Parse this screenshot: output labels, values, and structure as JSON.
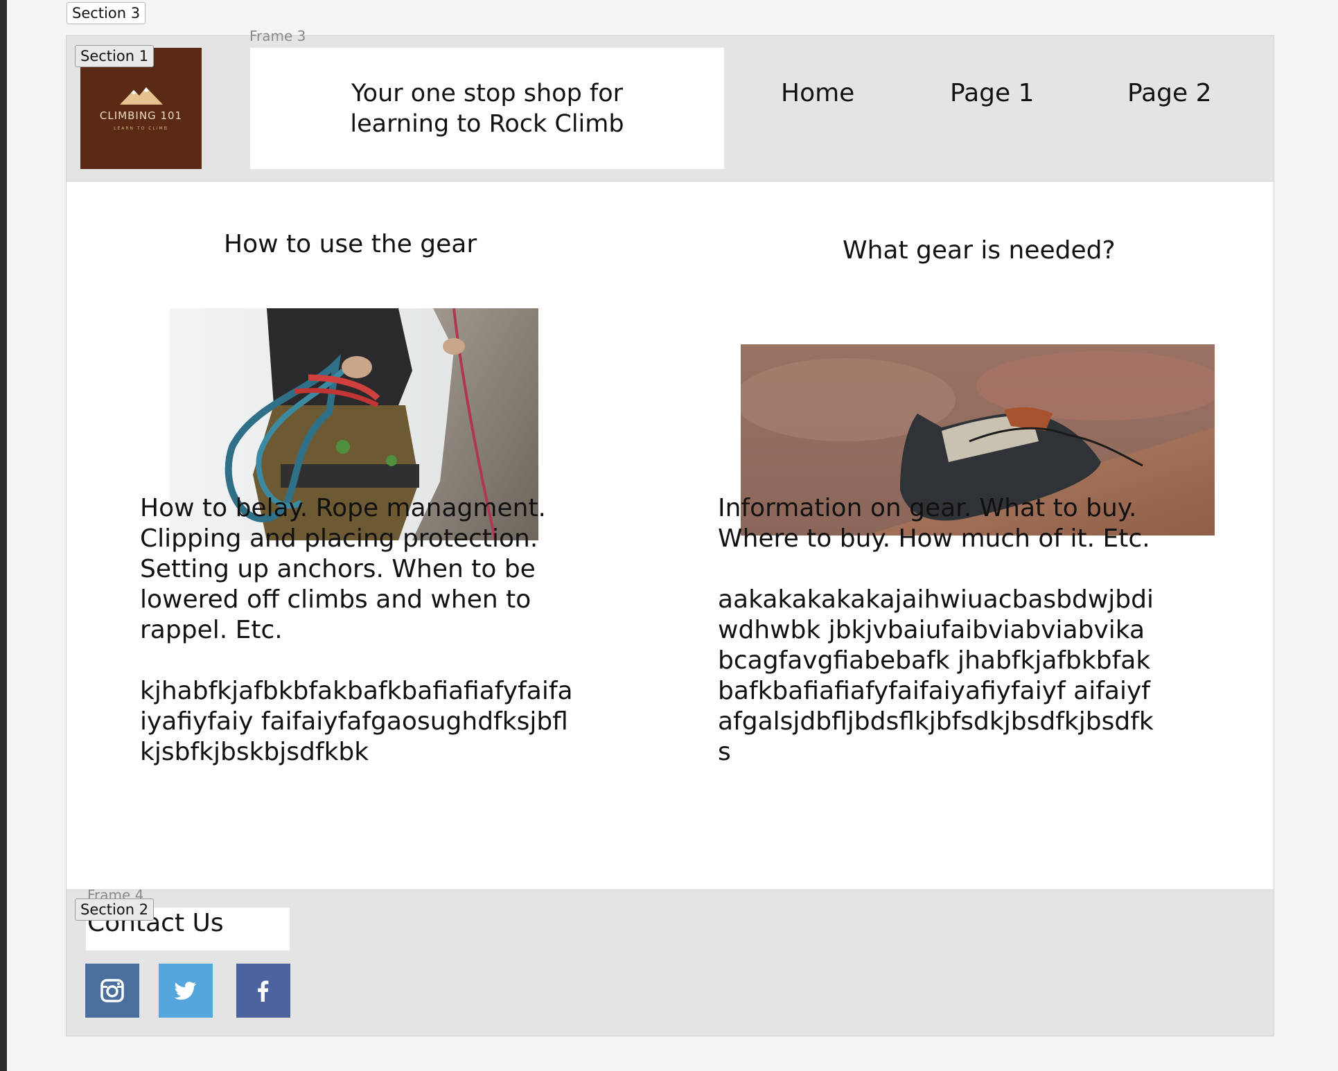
{
  "labels": {
    "section3": "Section 3",
    "section1": "Section 1",
    "section2": "Section 2",
    "frame3": "Frame 3",
    "frame4": "Frame 4"
  },
  "header": {
    "logo": {
      "title": "CLIMBING 101",
      "subtitle": "LEARN TO CLIMB",
      "bg_color": "#5a2a14"
    },
    "tagline": "Your one stop shop for learning to Rock Climb",
    "nav": [
      "Home",
      "Page 1",
      "Page 2"
    ]
  },
  "main": {
    "left": {
      "heading": "How to use the gear",
      "image_alt": "Climber with rope and gear rack on harness",
      "paragraph1": "How to belay. Rope managment. Clipping and placing protection. Setting up anchors. When to be lowered off climbs and when to rappel. Etc.",
      "paragraph2": "kjhabfkjafbkbfakbafkbafiafiafyfaifaiyafiyfaiy faifaiyfafgaosughdfksjbflkjsbfkjbskbjsdfkbk"
    },
    "right": {
      "heading": "What gear is needed?",
      "image_alt": "Climbing shoe on a rock ledge",
      "paragraph1": "Information on gear. What to buy. Where to buy. How much of it. Etc.",
      "paragraph2": "aakakakakakajaihwiuacbasbdwjbdiwdhwbk jbkjvbaiufaibviabviabvikabcagfavgfiabebafk jhabfkjafbkbfakbafkbafiafiafyfaifaiyafiyfaiyf aifaiyfafgalsjdbfljbdsflkjbfsdkjbsdfkjbsdfks"
    }
  },
  "footer": {
    "contact": "Contact Us",
    "social": [
      {
        "name": "instagram-icon",
        "color": "#4a6f9c"
      },
      {
        "name": "twitter-icon",
        "color": "#55a6dc"
      },
      {
        "name": "facebook-icon",
        "color": "#4d63a0"
      }
    ]
  }
}
